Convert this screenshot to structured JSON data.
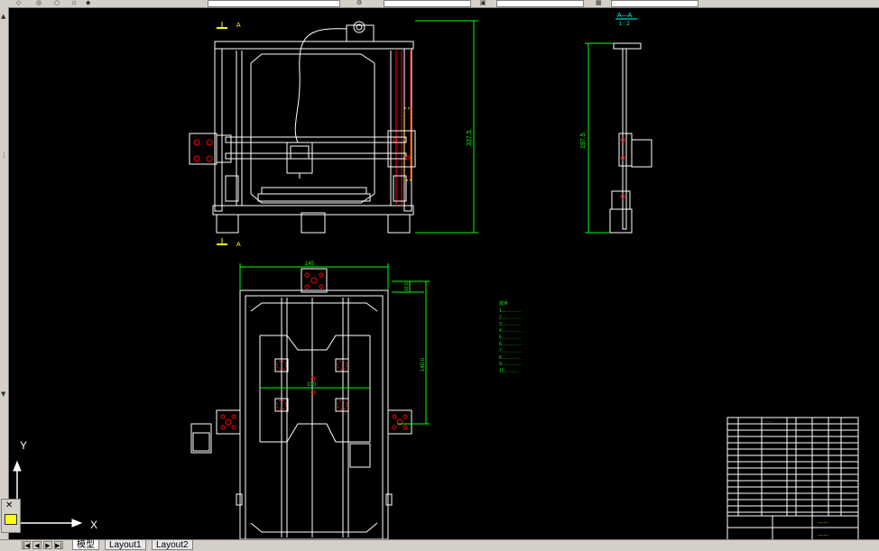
{
  "view_labels": {
    "section_arrow_top": "A",
    "section_arrow_bottom": "A",
    "side_view_title": "A—A",
    "side_view_scale": "1 : 2"
  },
  "dimensions": {
    "front_height": "337.5",
    "side_height": "197.5",
    "top_width": "145",
    "top_offset": "10.5",
    "top_depth": "140.0",
    "inner_span": "100"
  },
  "notes": {
    "heading": "技术",
    "lines": [
      "1.…………",
      "2.…………",
      "3.…………",
      "4.…………",
      "5.…………",
      "6.…………",
      "7.…………",
      "8.…………",
      "9.…………",
      "10.………"
    ]
  },
  "ucs": {
    "x_label": "X",
    "y_label": "Y"
  },
  "tabs": {
    "model": "模型",
    "layout1": "Layout1",
    "layout2": "Layout2"
  },
  "title_block": {
    "company": "……",
    "drawing_name": "……"
  },
  "colors": {
    "background": "#000000",
    "geometry": "#ffffff",
    "dimension": "#00ff00",
    "annotation": "#ffff00",
    "highlight": "#ff0000"
  }
}
